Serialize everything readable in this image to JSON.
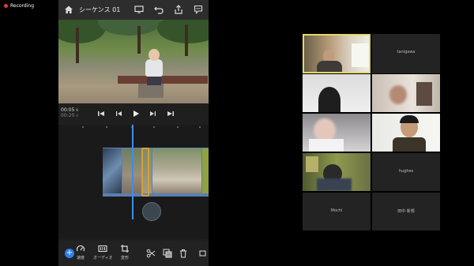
{
  "recording": {
    "label": "Recording",
    "color": "#e53935"
  },
  "editor": {
    "title": "シーケンス 01",
    "time_current": "00:05",
    "time_current_suffix": "9",
    "time_total": "00:20",
    "time_total_suffix": "4",
    "tools": [
      {
        "label": "速度",
        "icon": "speed-icon"
      },
      {
        "label": "オーディオ",
        "icon": "audio-icon"
      },
      {
        "label": "変形",
        "icon": "transform-icon"
      }
    ],
    "accent": "#2f80ed"
  },
  "participants": [
    {
      "name": "",
      "video": true,
      "active": true
    },
    {
      "name": "tanigawa",
      "video": false
    },
    {
      "name": "",
      "video": true
    },
    {
      "name": "",
      "video": true
    },
    {
      "name": "",
      "video": true
    },
    {
      "name": "",
      "video": true
    },
    {
      "name": "",
      "video": true
    },
    {
      "name": "hughes",
      "video": false
    },
    {
      "name": "Mochi",
      "video": false
    },
    {
      "name": "田中 新規",
      "video": false
    }
  ]
}
